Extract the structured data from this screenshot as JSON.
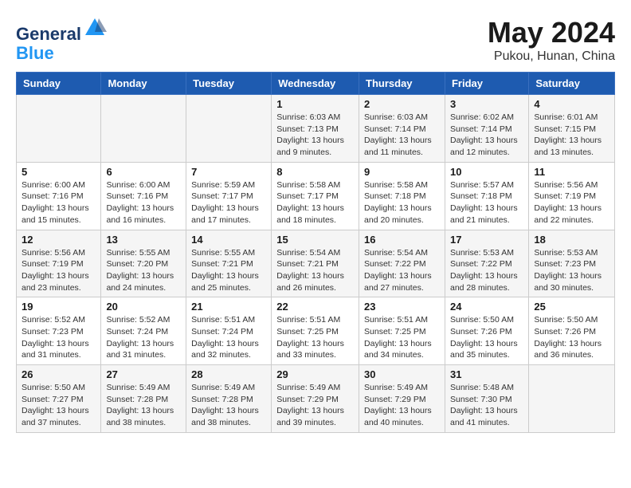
{
  "header": {
    "logo_general": "General",
    "logo_blue": "Blue",
    "month_year": "May 2024",
    "location": "Pukou, Hunan, China"
  },
  "days_of_week": [
    "Sunday",
    "Monday",
    "Tuesday",
    "Wednesday",
    "Thursday",
    "Friday",
    "Saturday"
  ],
  "weeks": [
    [
      {
        "day": "",
        "info": ""
      },
      {
        "day": "",
        "info": ""
      },
      {
        "day": "",
        "info": ""
      },
      {
        "day": "1",
        "info": "Sunrise: 6:03 AM\nSunset: 7:13 PM\nDaylight: 13 hours\nand 9 minutes."
      },
      {
        "day": "2",
        "info": "Sunrise: 6:03 AM\nSunset: 7:14 PM\nDaylight: 13 hours\nand 11 minutes."
      },
      {
        "day": "3",
        "info": "Sunrise: 6:02 AM\nSunset: 7:14 PM\nDaylight: 13 hours\nand 12 minutes."
      },
      {
        "day": "4",
        "info": "Sunrise: 6:01 AM\nSunset: 7:15 PM\nDaylight: 13 hours\nand 13 minutes."
      }
    ],
    [
      {
        "day": "5",
        "info": "Sunrise: 6:00 AM\nSunset: 7:16 PM\nDaylight: 13 hours\nand 15 minutes."
      },
      {
        "day": "6",
        "info": "Sunrise: 6:00 AM\nSunset: 7:16 PM\nDaylight: 13 hours\nand 16 minutes."
      },
      {
        "day": "7",
        "info": "Sunrise: 5:59 AM\nSunset: 7:17 PM\nDaylight: 13 hours\nand 17 minutes."
      },
      {
        "day": "8",
        "info": "Sunrise: 5:58 AM\nSunset: 7:17 PM\nDaylight: 13 hours\nand 18 minutes."
      },
      {
        "day": "9",
        "info": "Sunrise: 5:58 AM\nSunset: 7:18 PM\nDaylight: 13 hours\nand 20 minutes."
      },
      {
        "day": "10",
        "info": "Sunrise: 5:57 AM\nSunset: 7:18 PM\nDaylight: 13 hours\nand 21 minutes."
      },
      {
        "day": "11",
        "info": "Sunrise: 5:56 AM\nSunset: 7:19 PM\nDaylight: 13 hours\nand 22 minutes."
      }
    ],
    [
      {
        "day": "12",
        "info": "Sunrise: 5:56 AM\nSunset: 7:19 PM\nDaylight: 13 hours\nand 23 minutes."
      },
      {
        "day": "13",
        "info": "Sunrise: 5:55 AM\nSunset: 7:20 PM\nDaylight: 13 hours\nand 24 minutes."
      },
      {
        "day": "14",
        "info": "Sunrise: 5:55 AM\nSunset: 7:21 PM\nDaylight: 13 hours\nand 25 minutes."
      },
      {
        "day": "15",
        "info": "Sunrise: 5:54 AM\nSunset: 7:21 PM\nDaylight: 13 hours\nand 26 minutes."
      },
      {
        "day": "16",
        "info": "Sunrise: 5:54 AM\nSunset: 7:22 PM\nDaylight: 13 hours\nand 27 minutes."
      },
      {
        "day": "17",
        "info": "Sunrise: 5:53 AM\nSunset: 7:22 PM\nDaylight: 13 hours\nand 28 minutes."
      },
      {
        "day": "18",
        "info": "Sunrise: 5:53 AM\nSunset: 7:23 PM\nDaylight: 13 hours\nand 30 minutes."
      }
    ],
    [
      {
        "day": "19",
        "info": "Sunrise: 5:52 AM\nSunset: 7:23 PM\nDaylight: 13 hours\nand 31 minutes."
      },
      {
        "day": "20",
        "info": "Sunrise: 5:52 AM\nSunset: 7:24 PM\nDaylight: 13 hours\nand 31 minutes."
      },
      {
        "day": "21",
        "info": "Sunrise: 5:51 AM\nSunset: 7:24 PM\nDaylight: 13 hours\nand 32 minutes."
      },
      {
        "day": "22",
        "info": "Sunrise: 5:51 AM\nSunset: 7:25 PM\nDaylight: 13 hours\nand 33 minutes."
      },
      {
        "day": "23",
        "info": "Sunrise: 5:51 AM\nSunset: 7:25 PM\nDaylight: 13 hours\nand 34 minutes."
      },
      {
        "day": "24",
        "info": "Sunrise: 5:50 AM\nSunset: 7:26 PM\nDaylight: 13 hours\nand 35 minutes."
      },
      {
        "day": "25",
        "info": "Sunrise: 5:50 AM\nSunset: 7:26 PM\nDaylight: 13 hours\nand 36 minutes."
      }
    ],
    [
      {
        "day": "26",
        "info": "Sunrise: 5:50 AM\nSunset: 7:27 PM\nDaylight: 13 hours\nand 37 minutes."
      },
      {
        "day": "27",
        "info": "Sunrise: 5:49 AM\nSunset: 7:28 PM\nDaylight: 13 hours\nand 38 minutes."
      },
      {
        "day": "28",
        "info": "Sunrise: 5:49 AM\nSunset: 7:28 PM\nDaylight: 13 hours\nand 38 minutes."
      },
      {
        "day": "29",
        "info": "Sunrise: 5:49 AM\nSunset: 7:29 PM\nDaylight: 13 hours\nand 39 minutes."
      },
      {
        "day": "30",
        "info": "Sunrise: 5:49 AM\nSunset: 7:29 PM\nDaylight: 13 hours\nand 40 minutes."
      },
      {
        "day": "31",
        "info": "Sunrise: 5:48 AM\nSunset: 7:30 PM\nDaylight: 13 hours\nand 41 minutes."
      },
      {
        "day": "",
        "info": ""
      }
    ]
  ]
}
